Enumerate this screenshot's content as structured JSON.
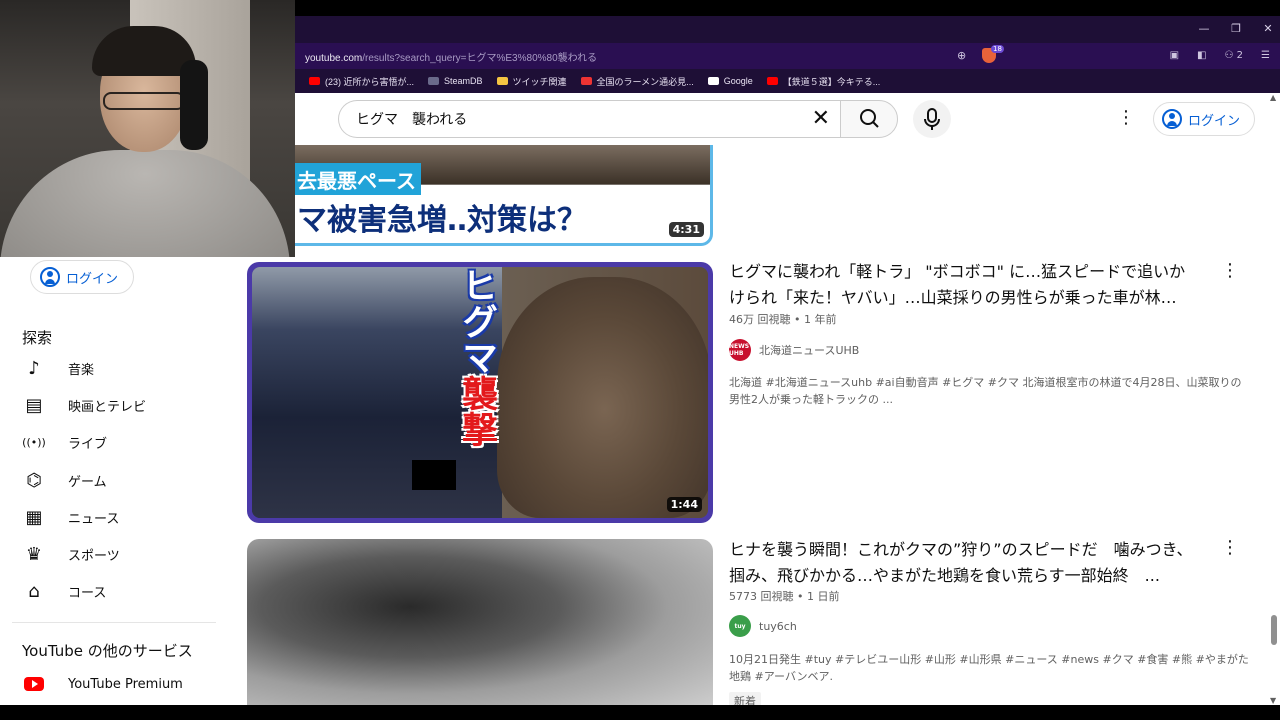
{
  "browser": {
    "url_host": "youtube.com",
    "url_rest": "/results?search_query=ヒグマ%E3%80%80襲われる",
    "brave_badge_count": "18",
    "profile_count": "2",
    "bookmarks": [
      {
        "label": "(23) 近所から害悟が...",
        "color": "#ff0000"
      },
      {
        "label": "SteamDB",
        "color": "#6a6a8a"
      },
      {
        "label": "ツイッチ関連",
        "color": "#f5c542"
      },
      {
        "label": "全国のラーメン通必見...",
        "color": "#e33"
      },
      {
        "label": "Google",
        "color": "#ffffff"
      },
      {
        "label": "【鉄道５選】今キテる...",
        "color": "#ff0000"
      }
    ]
  },
  "header": {
    "search_value": "ヒグマ　襲われる",
    "login_label": "ログイン"
  },
  "sidebar": {
    "login_label": "ログイン",
    "explore_title": "探索",
    "items": [
      {
        "label": "音楽",
        "icon": "music-note-icon"
      },
      {
        "label": "映画とテレビ",
        "icon": "film-icon"
      },
      {
        "label": "ライブ",
        "icon": "live-icon"
      },
      {
        "label": "ゲーム",
        "icon": "gamepad-icon"
      },
      {
        "label": "ニュース",
        "icon": "news-icon"
      },
      {
        "label": "スポーツ",
        "icon": "trophy-icon"
      },
      {
        "label": "コース",
        "icon": "graduation-cap-icon"
      }
    ],
    "more_services_title": "YouTube の他のサービス",
    "premium_label": "YouTube Premium"
  },
  "videos": [
    {
      "thumb_band_text": "去最悪ペース",
      "thumb_main_text": "マ被害急増‥対策は？",
      "duration": "4:31"
    },
    {
      "thumb_text_top": "ヒグマ",
      "thumb_text_bottom": "襲撃",
      "duration": "1:44",
      "title": "ヒグマに襲われ「軽トラ」 \"ボコボコ\" に…猛スピードで追いかけられ「来た！ヤバい」…山菜採りの男性らが乗った車が林…",
      "meta": "46万 回視聴 • 1 年前",
      "channel": "北海道ニュースUHB",
      "channel_avatar_text": "NEWS UHB",
      "description": "北海道 #北海道ニュースuhb #ai自動音声 #ヒグマ #クマ 北海道根室市の林道で4月28日、山菜取りの男性2人が乗った軽トラックの ..."
    },
    {
      "title": "ヒナを襲う瞬間！これがクマの”狩り”のスピードだ　噛みつき、掴み、飛びかかる…やまがた地鶏を食い荒らす一部始終　...",
      "meta": "5773 回視聴 • 1 日前",
      "channel": "tuy6ch",
      "channel_avatar_text": "tuy",
      "description": "10月21日発生 #tuy #テレビユー山形 #山形 #山形県 #ニュース #news #クマ #食害 #熊 #やまがた地鶏 #アーバンベア.",
      "badge": "新着"
    }
  ]
}
